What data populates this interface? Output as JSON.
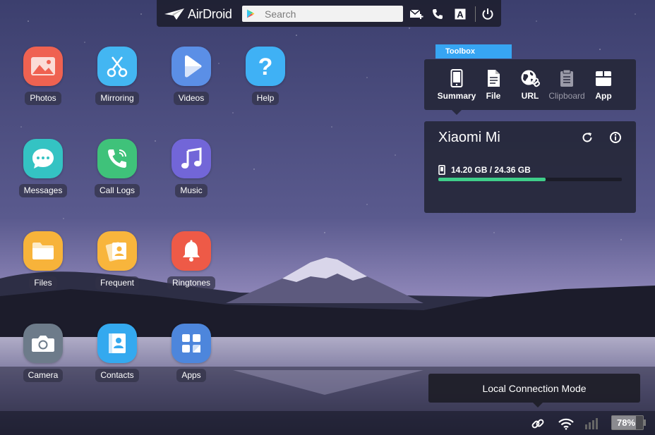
{
  "topbar": {
    "logo_text": "AirDroid",
    "search_placeholder": "Search",
    "font_icon_letter": "A"
  },
  "apps": [
    {
      "label": "Photos",
      "icon": "photos-icon",
      "color": "#ef6251"
    },
    {
      "label": "Mirroring",
      "icon": "scissors-icon",
      "color": "#43b6f2"
    },
    {
      "label": "Videos",
      "icon": "play-icon",
      "color": "#5b8fe6"
    },
    {
      "label": "Help",
      "icon": "question-icon",
      "color": "#3fb1f5"
    },
    {
      "label": "Messages",
      "icon": "chat-icon",
      "color": "#34c3c3"
    },
    {
      "label": "Call Logs",
      "icon": "phone-icon",
      "color": "#3fc27a"
    },
    {
      "label": "Music",
      "icon": "music-note-icon",
      "color": "#7266d8"
    },
    {
      "label": "Files",
      "icon": "folder-icon",
      "color": "#f7b33a"
    },
    {
      "label": "Frequent",
      "icon": "contact-card-icon",
      "color": "#f8b53c"
    },
    {
      "label": "Ringtones",
      "icon": "bell-icon",
      "color": "#ee5a47"
    },
    {
      "label": "Camera",
      "icon": "camera-icon",
      "color": "#6d7b8a"
    },
    {
      "label": "Contacts",
      "icon": "contacts-book-icon",
      "color": "#34a9ef"
    },
    {
      "label": "Apps",
      "icon": "apps-grid-icon",
      "color": "#4d86dc"
    }
  ],
  "toolbox": {
    "title": "Toolbox",
    "tools": [
      {
        "label": "Summary",
        "icon": "phone-outline-icon",
        "enabled": true
      },
      {
        "label": "File",
        "icon": "file-icon",
        "enabled": true
      },
      {
        "label": "URL",
        "icon": "globe-link-icon",
        "enabled": true
      },
      {
        "label": "Clipboard",
        "icon": "clipboard-icon",
        "enabled": false
      },
      {
        "label": "App",
        "icon": "package-icon",
        "enabled": true
      }
    ]
  },
  "device": {
    "name": "Xiaomi Mi",
    "storage_text": "14.20 GB / 24.36 GB",
    "storage_used_fraction": 0.583
  },
  "status": {
    "connection_mode": "Local Connection Mode",
    "battery_text": "78%",
    "battery_level": 0.78
  },
  "colors": {
    "toolbox_accent": "#37a5f3",
    "storage_fill": "#3fce8a"
  }
}
